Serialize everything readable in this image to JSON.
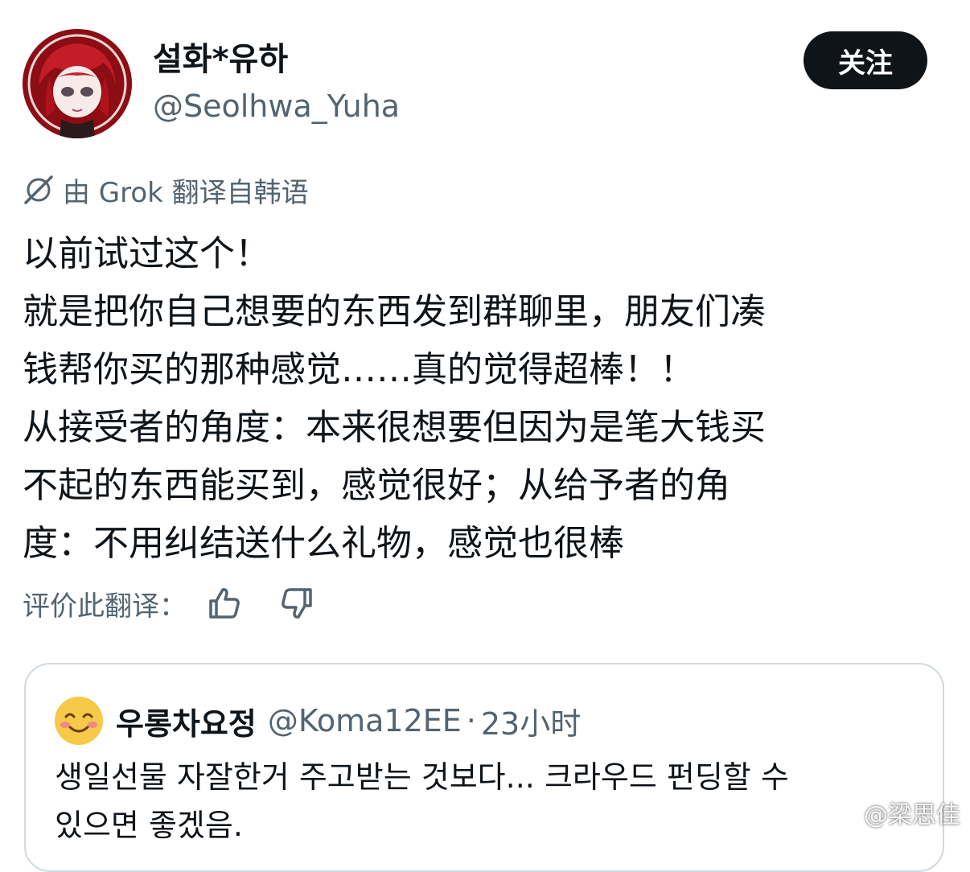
{
  "author": {
    "display_name": "설화*유하",
    "handle": "@Seolhwa_Yuha",
    "avatar_icon": "anime-avatar-red-hair"
  },
  "follow_button": {
    "label": "关注"
  },
  "translation_notice": {
    "text": "由 Grok 翻译自韩语",
    "icon": "grok-icon"
  },
  "tweet": {
    "lines": [
      "以前试过这个！",
      "就是把你自己想要的东西发到群聊里，朋友们凑",
      "钱帮你买的那种感觉……真的觉得超棒！！",
      "从接受者的角度：本来很想要但因为是笔大钱买",
      "不起的东西能买到，感觉很好；从给予者的角",
      "度：不用纠结送什么礼物，感觉也很棒"
    ]
  },
  "rate_translation": {
    "label": "评价此翻译：",
    "like_icon": "thumbs-up-icon",
    "dislike_icon": "thumbs-down-icon"
  },
  "quoted_tweet": {
    "display_name": "우롱차요정",
    "handle": "@Koma12EE",
    "separator": "·",
    "time": "23小时",
    "avatar_icon": "smiling-face-emoji",
    "lines": [
      "생일선물 자잘한거 주고받는 것보다... 크라우드 펀딩할 수",
      "있으면 좋겠음."
    ]
  },
  "watermark": {
    "text": "@梁思佳",
    "icon": "weibo-logo"
  },
  "colors": {
    "text_primary": "#0f1419",
    "text_secondary": "#536471",
    "border": "#cfd9de",
    "button_bg": "#0f1419",
    "avatar_red": "#7a0b10"
  }
}
